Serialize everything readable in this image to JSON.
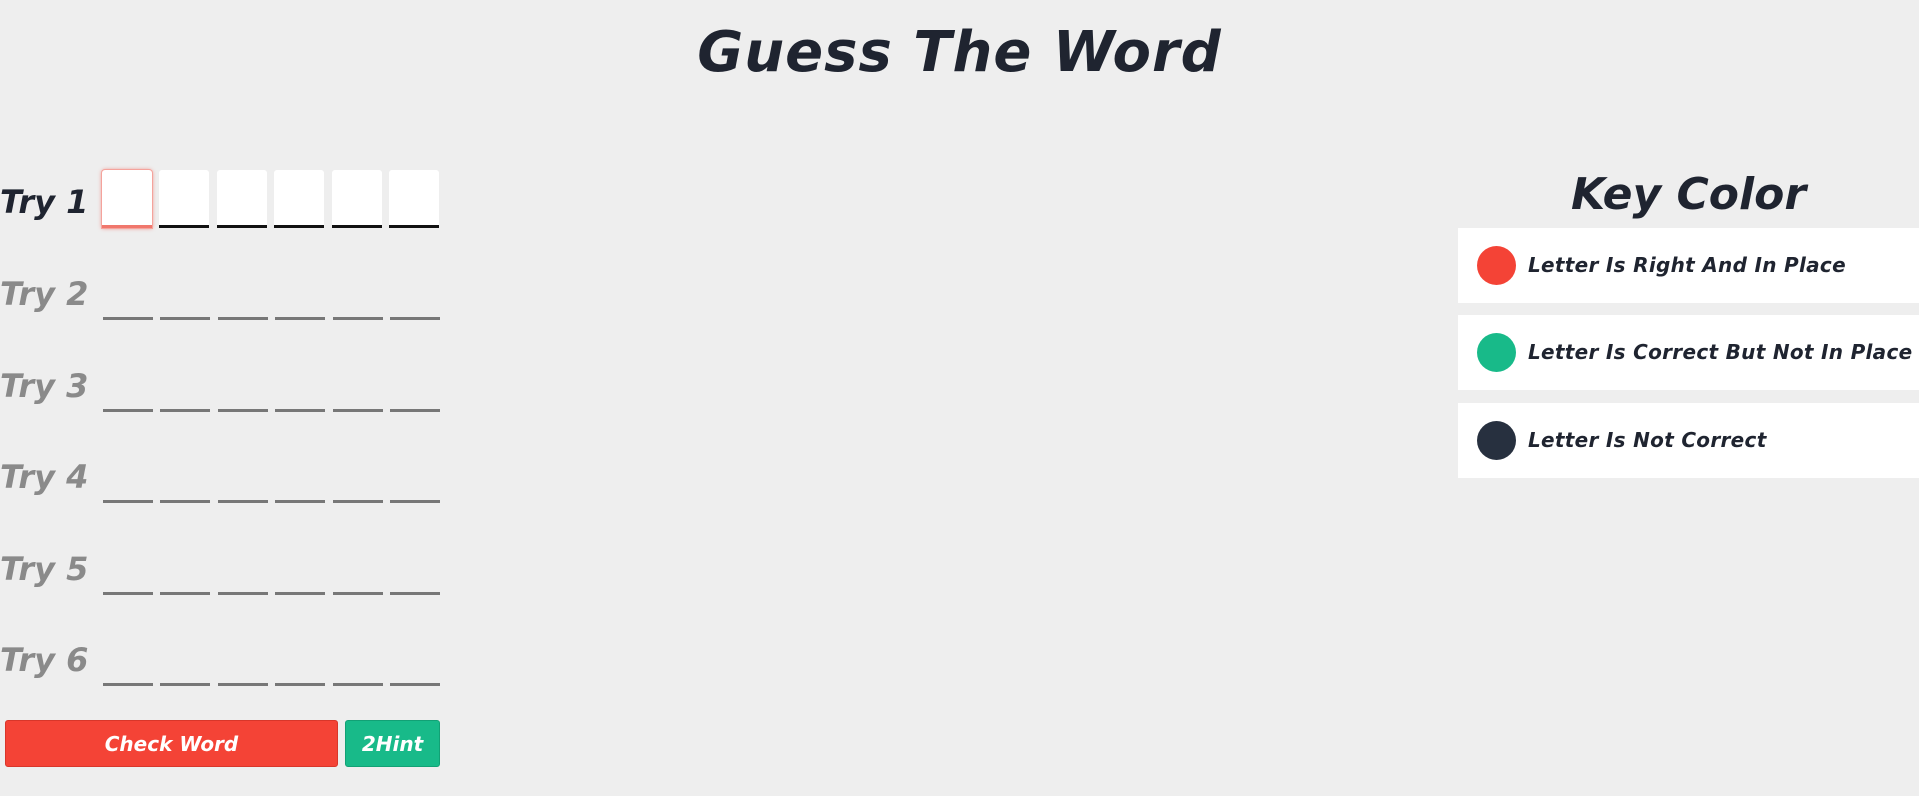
{
  "title": "Guess The Word",
  "tries": [
    {
      "label": "Try 1",
      "active": true
    },
    {
      "label": "Try 2",
      "active": false
    },
    {
      "label": "Try 3",
      "active": false
    },
    {
      "label": "Try 4",
      "active": false
    },
    {
      "label": "Try 5",
      "active": false
    },
    {
      "label": "Try 6",
      "active": false
    }
  ],
  "letters_per_try": 6,
  "buttons": {
    "check_label": "Check Word",
    "hint_label": "2Hint"
  },
  "key": {
    "title": "Key Color",
    "items": [
      {
        "text": "Letter Is Right And In Place",
        "color": "#f44336"
      },
      {
        "text": "Letter Is Correct But Not In Place",
        "color": "#18ba89"
      },
      {
        "text": "Letter Is Not Correct",
        "color": "#27303f"
      }
    ]
  },
  "colors": {
    "background": "#eeeeee",
    "text": "#1f2430",
    "inactive_text": "#8a8a8a",
    "check_button": "#f44336",
    "hint_button": "#18ba89"
  }
}
